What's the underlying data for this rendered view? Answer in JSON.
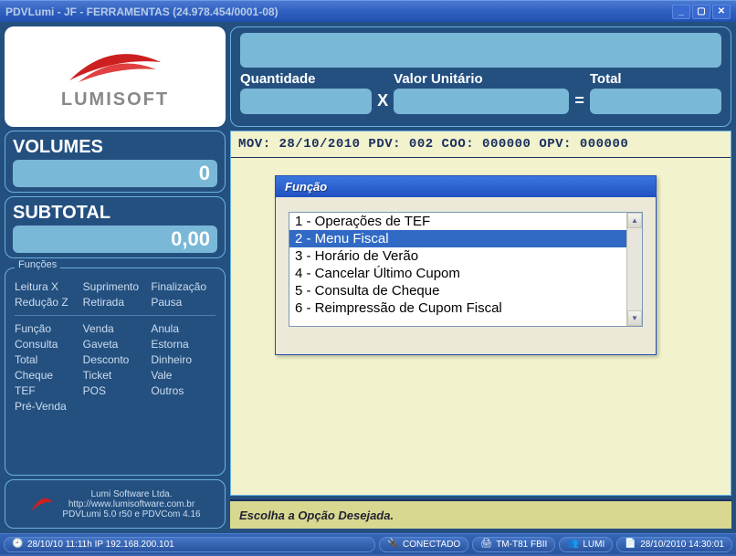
{
  "window": {
    "title": "PDVLumi - JF - FERRAMENTAS (24.978.454/0001-08)"
  },
  "logo": {
    "text": "LUMISOFT"
  },
  "volumes": {
    "label": "VOLUMES",
    "value": "0"
  },
  "subtotal": {
    "label": "SUBTOTAL",
    "value": "0,00"
  },
  "funcoes": {
    "legend": "Funções",
    "row1": [
      "Leitura X",
      "Suprimento",
      "Finalização"
    ],
    "row2": [
      "Redução Z",
      "Retirada",
      "Pausa"
    ],
    "row3": [
      "Função",
      "Venda",
      "Anula"
    ],
    "row4": [
      "Consulta",
      "Gaveta",
      "Estorna"
    ],
    "row5": [
      "Total",
      "Desconto",
      "Dinheiro"
    ],
    "row6": [
      "Cheque",
      "Ticket",
      "Vale"
    ],
    "row7": [
      "TEF",
      "POS",
      "Outros"
    ],
    "row8": [
      "Pré-Venda",
      "",
      ""
    ]
  },
  "software": {
    "company": "Lumi Software Ltda.",
    "url": "http://www.lumisoftware.com.br",
    "ver": "PDVLumi 5.0 r50 e PDVCom 4.16"
  },
  "top": {
    "qty_label": "Quantidade",
    "unit_label": "Valor Unitário",
    "total_label": "Total",
    "x": "X",
    "eq": "="
  },
  "mov": {
    "line": "MOV: 28/10/2010  PDV: 002  COO: 000000  OPV: 000000"
  },
  "funcao_dialog": {
    "title": "Função",
    "items": [
      "1 - Operações de TEF",
      "2 - Menu Fiscal",
      "3 - Horário de Verão",
      "4 - Cancelar Último Cupom",
      "5 - Consulta de Cheque",
      "6 - Reimpressão de Cupom Fiscal"
    ],
    "selected_index": 1
  },
  "prompt": {
    "text": "Escolha a Opção Desejada."
  },
  "status": {
    "seg1": "28/10/10 11:11h  IP 192.168.200.101",
    "seg2": "CONECTADO",
    "seg3": "TM-T81 FBII",
    "seg4": "LUMI",
    "seg5": "28/10/2010  14:30:01"
  },
  "icons": {
    "clock": "🕘",
    "plug": "🔌",
    "printer": "🖨",
    "user": "👥",
    "page": "📄"
  }
}
